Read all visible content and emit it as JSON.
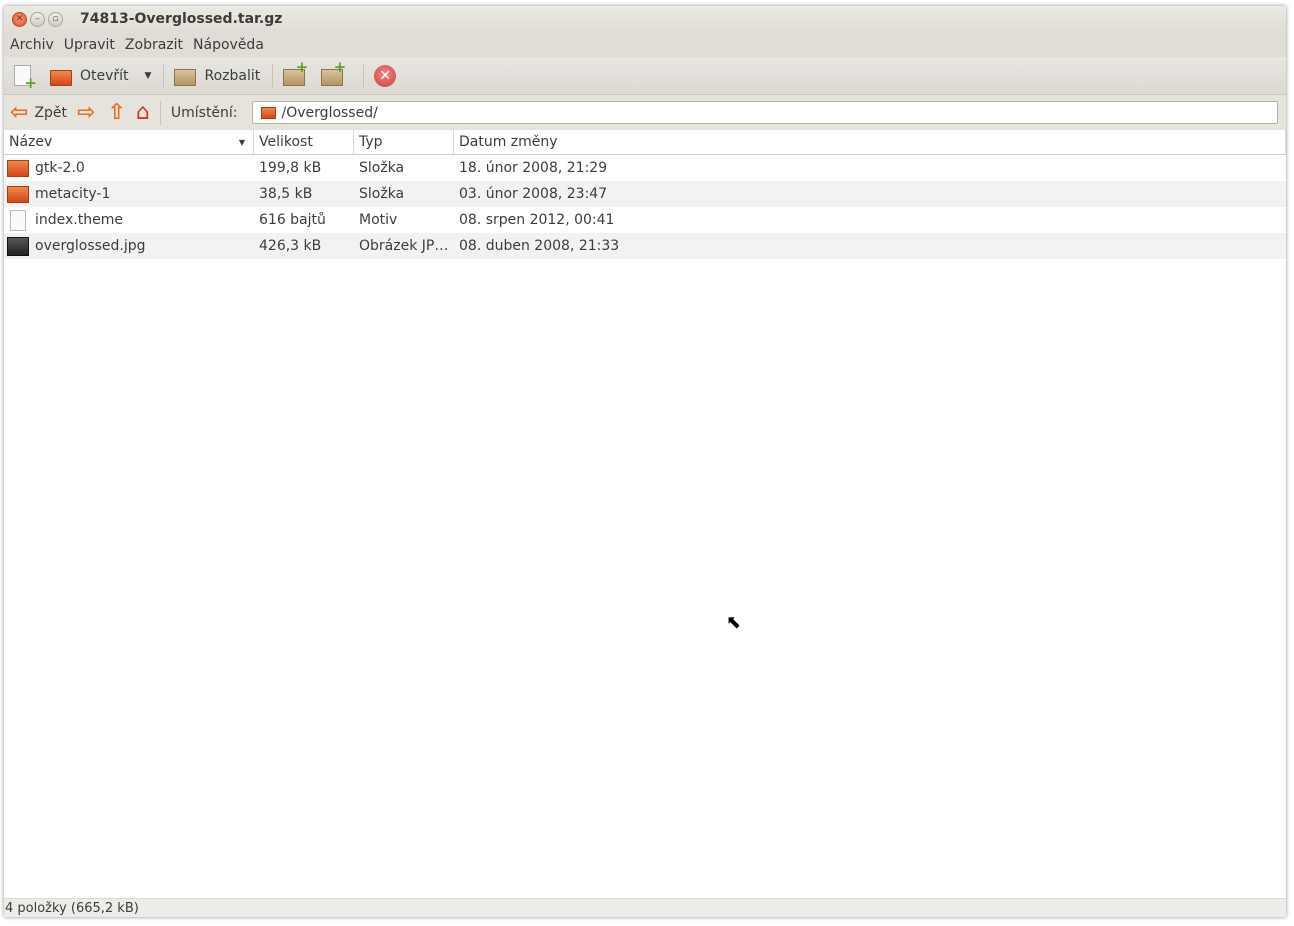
{
  "window": {
    "title": "74813-Overglossed.tar.gz"
  },
  "menu": [
    "Archiv",
    "Upravit",
    "Zobrazit",
    "Nápověda"
  ],
  "toolbar": {
    "open_label": "Otevřít",
    "extract_label": "Rozbalit"
  },
  "location": {
    "back_label": "Zpět",
    "label": "Umístění:",
    "path": "/Overglossed/"
  },
  "columns": [
    "Název",
    "Velikost",
    "Typ",
    "Datum změny"
  ],
  "files": [
    {
      "name": "gtk-2.0",
      "size": "199,8 kB",
      "type": "Složka",
      "date": "18. únor 2008, 21:29",
      "icon": "folder"
    },
    {
      "name": "metacity-1",
      "size": "38,5 kB",
      "type": "Složka",
      "date": "03. únor 2008, 23:47",
      "icon": "folder"
    },
    {
      "name": "index.theme",
      "size": "616 bajtů",
      "type": "Motiv",
      "date": "08. srpen 2012, 00:41",
      "icon": "text"
    },
    {
      "name": "overglossed.jpg",
      "size": "426,3 kB",
      "type": "Obrázek JP…",
      "date": "08. duben 2008, 21:33",
      "icon": "image"
    }
  ],
  "status": "4 položky (665,2 kB)"
}
